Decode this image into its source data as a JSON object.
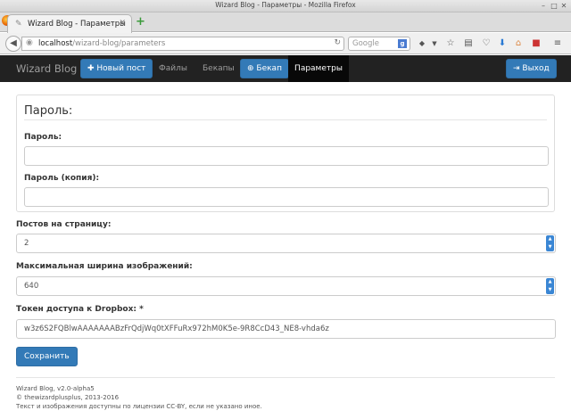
{
  "window": {
    "title": "Wizard Blog - Параметры - Mozilla Firefox"
  },
  "browser": {
    "tab_title": "Wizard Blog - Параметры",
    "url_host": "localhost",
    "url_path": "/wizard-blog/parameters",
    "search_placeholder": "Google",
    "search_engine_letter": "g"
  },
  "navbar": {
    "brand": "Wizard Blog",
    "new_post": "Новый пост",
    "files": "Файлы",
    "backups": "Бекапы",
    "backup": "Бекап",
    "parameters": "Параметры",
    "logout": "Выход"
  },
  "form": {
    "password_legend": "Пароль:",
    "password_label": "Пароль:",
    "password_value": "",
    "password_confirm_label": "Пароль (копия):",
    "password_confirm_value": "",
    "posts_per_page_label": "Постов на страницу:",
    "posts_per_page_value": "2",
    "max_image_width_label": "Максимальная ширина изображений:",
    "max_image_width_value": "640",
    "dropbox_token_label": "Токен доступа к Dropbox: *",
    "dropbox_token_value": "w3z6S2FQBlwAAAAAAABzFrQdjWq0tXFFuRx972hM0K5e-9R8CcD43_NE8-vhda6z",
    "save_button": "Сохранить"
  },
  "footer": {
    "version": "Wizard Blog, v2.0-alpha5",
    "copyright": "© thewizardplusplus, 2013-2016",
    "license": "Текст и изображения доступны по лицензии CC-BY, если не указано иное."
  },
  "colors": {
    "primary": "#337ab7",
    "navbar_bg": "#222222"
  }
}
